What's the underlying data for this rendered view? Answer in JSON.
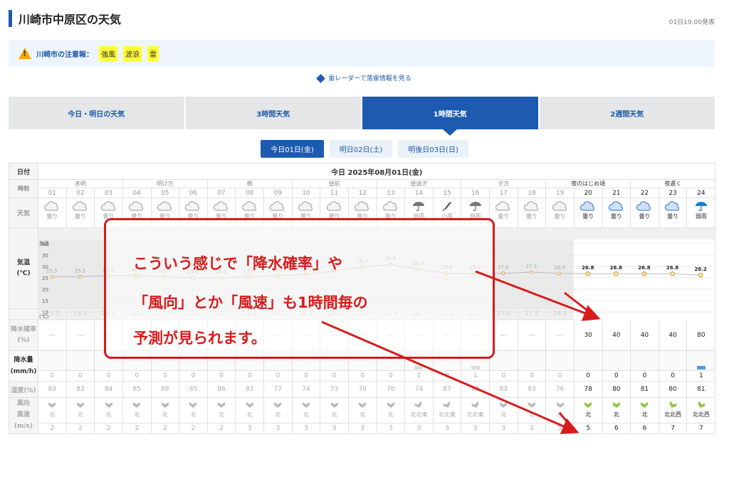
{
  "header": {
    "title": "川崎市中原区の天気",
    "issued": "01日19:00発表"
  },
  "alert": {
    "label": "川崎市の注意報：",
    "items": [
      "強風",
      "波浪",
      "雷"
    ]
  },
  "radar_link": "雷レーダーで落雷情報を見る",
  "tabs": [
    "今日・明日の天気",
    "3時間天気",
    "1時間天気",
    "2週間天気"
  ],
  "active_tab": 2,
  "day_buttons": [
    "今日01日(金)",
    "明日02日(土)",
    "明後日03日(日)"
  ],
  "row_labels": {
    "date": "日付",
    "time": "時刻",
    "weather": "天気",
    "temp": "気温",
    "temp_unit": "(℃)",
    "pop": "降水確率",
    "pop_unit": "(%)",
    "precip": "降水量",
    "precip_unit": "(mm/h)",
    "humidity": "湿度(%)",
    "wind_dir": "風向",
    "wind_speed": "風速",
    "wind_unit": "(m/s)"
  },
  "date_text": "今日 2025年08月01日(金)",
  "time_bands": [
    {
      "label": "未明",
      "span": 3
    },
    {
      "label": "明け方",
      "span": 3
    },
    {
      "label": "朝",
      "span": 3
    },
    {
      "label": "昼前",
      "span": 3
    },
    {
      "label": "昼過ぎ",
      "span": 3
    },
    {
      "label": "夕方",
      "span": 3
    },
    {
      "label": "夜のはじめ頃",
      "span": 3
    },
    {
      "label": "夜遅く",
      "span": 3
    }
  ],
  "hours": [
    "01",
    "02",
    "03",
    "04",
    "05",
    "06",
    "07",
    "08",
    "09",
    "10",
    "11",
    "12",
    "13",
    "14",
    "15",
    "16",
    "17",
    "18",
    "19",
    "20",
    "21",
    "22",
    "23",
    "24"
  ],
  "weather": [
    "曇り",
    "曇り",
    "曇り",
    "曇り",
    "曇り",
    "曇り",
    "曇り",
    "曇り",
    "曇り",
    "曇り",
    "曇り",
    "曇り",
    "曇り",
    "弱雨",
    "小雨",
    "弱雨",
    "曇り",
    "曇り",
    "曇り",
    "曇り",
    "曇り",
    "曇り",
    "曇り",
    "弱雨"
  ],
  "weather_icons": [
    "cloud",
    "cloud",
    "cloud",
    "cloud",
    "cloud",
    "cloud",
    "cloud",
    "cloud",
    "cloud",
    "cloud",
    "cloud",
    "cloud",
    "cloud",
    "umbrella",
    "umbrella-closed",
    "umbrella",
    "cloud",
    "cloud",
    "cloud",
    "cloud",
    "cloud",
    "cloud",
    "cloud",
    "umbrella"
  ],
  "temp_axis": {
    "label": "気温",
    "unit": "(℃)",
    "ticks": [
      40,
      35,
      30,
      25,
      20,
      15,
      10
    ],
    "ylim": [
      10,
      40
    ]
  },
  "temperature": [
    25.5,
    25.5,
    26.0,
    26.0,
    25.5,
    25.0,
    25.0,
    25.5,
    26.0,
    26.5,
    28.0,
    29.7,
    30.9,
    28.7,
    27.0,
    27.0,
    27.0,
    27.5,
    26.9,
    26.8,
    26.8,
    26.8,
    26.8,
    26.2
  ],
  "pop": [
    "---",
    "---",
    "---",
    "---",
    "---",
    "---",
    "---",
    "---",
    "---",
    "---",
    "---",
    "---",
    "---",
    "---",
    "---",
    "---",
    "---",
    "---",
    "---",
    "30",
    "40",
    "40",
    "40",
    "80"
  ],
  "precip": [
    0,
    0,
    0,
    0,
    0,
    0,
    0,
    0,
    0,
    0,
    0,
    0,
    0,
    1,
    0,
    1,
    0,
    0,
    0,
    0,
    0,
    0,
    0,
    1
  ],
  "humidity": [
    83,
    83,
    84,
    85,
    88,
    85,
    86,
    83,
    77,
    74,
    73,
    70,
    70,
    74,
    87,
    83,
    83,
    83,
    76,
    78,
    80,
    81,
    80,
    81
  ],
  "wind_dir": [
    "北",
    "北",
    "北",
    "北",
    "北",
    "北",
    "北",
    "北",
    "北",
    "北",
    "北",
    "北",
    "北",
    "北北東",
    "北北東",
    "北北東",
    "北",
    "北",
    "北",
    "北",
    "北",
    "北",
    "北北西",
    "北北西"
  ],
  "wind_speed": [
    2,
    2,
    2,
    2,
    2,
    2,
    2,
    3,
    3,
    3,
    3,
    3,
    3,
    3,
    3,
    3,
    3,
    3,
    5,
    5,
    6,
    6,
    7,
    7
  ],
  "current_from_index": 19,
  "annotation": {
    "lines": [
      "こういう感じで「降水確率」や",
      "「風向」とか「風速」も1時間毎の",
      "予測が見られます。"
    ]
  },
  "colors": {
    "accent": "#1c5bb0",
    "alert_chip": "#ffff33",
    "annotation": "#d81b1b",
    "wind_arrow": "#8cc63f",
    "temp_marker": "#e8a030"
  }
}
